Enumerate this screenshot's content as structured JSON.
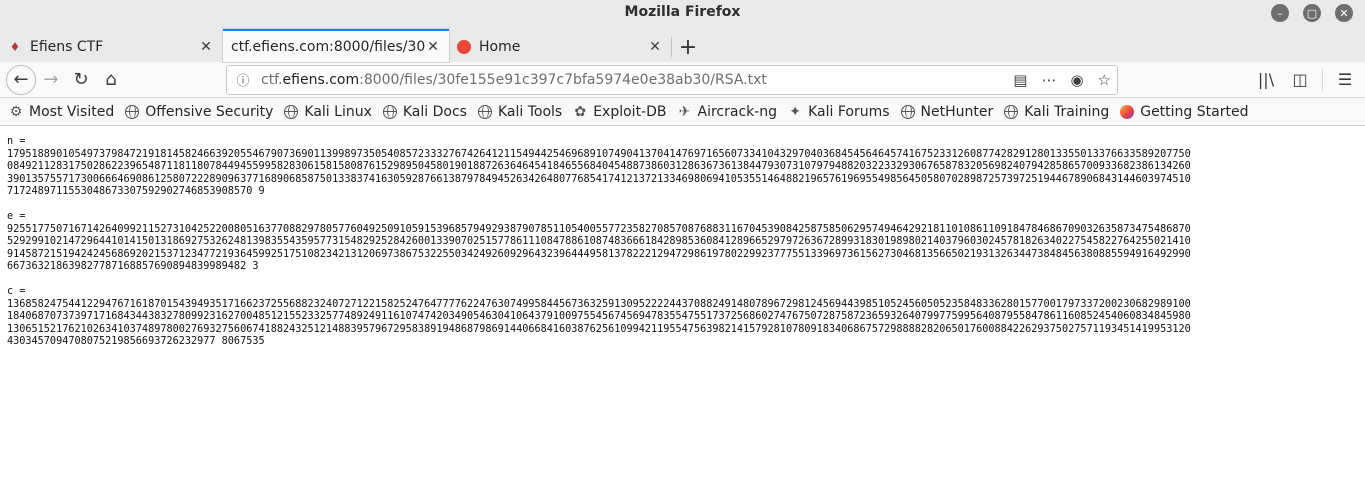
{
  "window": {
    "title": "Mozilla Firefox",
    "controls": [
      "minimize-icon",
      "maximize-icon",
      "close-icon"
    ]
  },
  "tabs": [
    {
      "label": "Efiens CTF",
      "icon": "ctf-favicon",
      "active": false
    },
    {
      "label": "ctf.efiens.com:8000/files/30",
      "icon": "",
      "active": true
    },
    {
      "label": "Home",
      "icon": "home-favicon",
      "active": false
    }
  ],
  "navbar": {
    "url_prefix": "ctf.",
    "url_host": "efiens.com",
    "url_rest": ":8000/files/30fe155e91c397c7bfa5974e0e38ab30/RSA.txt"
  },
  "bookmarks": [
    {
      "label": "Most Visited",
      "icon": "gear-icon"
    },
    {
      "label": "Offensive Security",
      "icon": "globe-icon"
    },
    {
      "label": "Kali Linux",
      "icon": "globe-icon"
    },
    {
      "label": "Kali Docs",
      "icon": "globe-icon"
    },
    {
      "label": "Kali Tools",
      "icon": "globe-icon"
    },
    {
      "label": "Exploit-DB",
      "icon": "exploit-db-icon"
    },
    {
      "label": "Aircrack-ng",
      "icon": "aircrack-icon"
    },
    {
      "label": "Kali Forums",
      "icon": "kali-dragon-icon"
    },
    {
      "label": "NetHunter",
      "icon": "globe-icon"
    },
    {
      "label": "Kali Training",
      "icon": "globe-icon"
    },
    {
      "label": "Getting Started",
      "icon": "firefox-icon"
    }
  ],
  "document": {
    "n_label": "n =",
    "n_lines": [
      "1795188901054973798472191814582466392055467907369011399897350540857233327674264121154944254696891074904137041476971656073341043297040368454564645741675233126087742829128013355013376633589207750",
      "0849211283175028622396548711811807844945599582830615815808761529895045801901887263646454184655684045488738603128636736138447930731079794882032233293067658783205698240794285865700933682386134260",
      "3901357557173006664690861258072228909637716890685875013383741630592876613879784945263426480776854174121372133469806941053551464882196576196955498564505807028987257397251944678906843144603974510",
      "7172489711553048673307592902746853908570 9"
    ],
    "e_label": "e =",
    "e_lines": [
      "9255177507167142640992115273104252200805163770882978057760492509105915396857949293879078511054005577235827085708768831167045390842587585062957494642921811010861109184784686709032635873475486870",
      "5292991021472964410141501318692753262481398355435957731548292528426001339070251577861110847886108748366618428985360841289665297972636728993183019898021403796030245781826340227545822764255021410",
      "9145872151942424568692021537123477219364599251751082342131206973867532255034249260929643239644495813782221294729861978022992377755133969736156273046813566502193132634473848456380885594916492990",
      "667363218639827787168857690894839989482 3"
    ],
    "c_label": "c =",
    "c_lines": [
      "1368582475441229476716187015439493517166237255688232407271221582524764777762247630749958445673632591309522224437088249148078967298124569443985105245605052358483362801577001797337200230682989100",
      "1840687073739717168434438327809923162700485121552332577489249116107474203490546304106437910097554567456947835547551737256860274767507287587236593264079977599564087955847861160852454060834845980",
      "1306515217621026341037489780027693275606741882432512148839579672958389194868798691440668416038762561099421195547563982141579281078091834068675729888828206501760088422629375027571193451419953120",
      "4303457094708075219856693726232977 8067535"
    ]
  }
}
